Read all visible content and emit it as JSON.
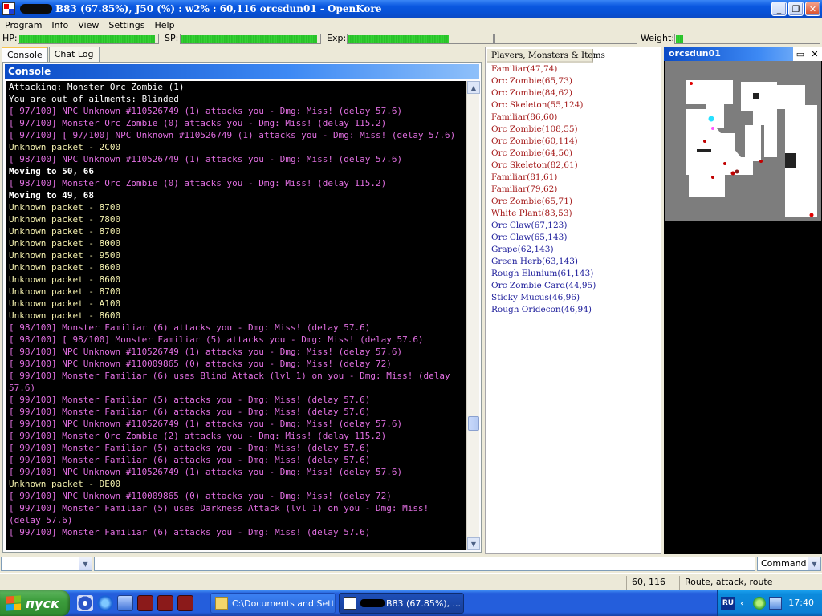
{
  "window": {
    "title": "B83 (67.85%), J50 (%) : w2% : 60,116 orcsdun01 - OpenKore",
    "btn_min": "_",
    "btn_max": "❐",
    "btn_close": "✕"
  },
  "menu": [
    "Program",
    "Info",
    "View",
    "Settings",
    "Help"
  ],
  "stats": {
    "hp_label": "HP:",
    "hp_fill": 0.98,
    "sp_label": "SP:",
    "sp_fill": 0.98,
    "exp_label": "Exp:",
    "exp_fill": 0.7,
    "weight_label": "Weight:",
    "weight_fill": 0.06
  },
  "tabs": [
    "Console",
    "Chat Log"
  ],
  "console": {
    "title": "Console",
    "lines": [
      {
        "c": "c-white",
        "t": "Attacking: Monster Orc Zombie (1)"
      },
      {
        "c": "c-white",
        "t": "You are out of ailments: Blinded"
      },
      {
        "c": "c-magenta",
        "t": "[ 97/100] NPC Unknown #110526749 (1) attacks you - Dmg: Miss! (delay 57.6)"
      },
      {
        "c": "c-magenta",
        "t": "[ 97/100] Monster Orc Zombie (0) attacks you - Dmg: Miss! (delay 115.2)"
      },
      {
        "c": "c-magenta",
        "t": "[ 97/100] [ 97/100] NPC Unknown #110526749 (1) attacks you - Dmg: Miss! (delay 57.6)"
      },
      {
        "c": "c-yellow",
        "t": "Unknown packet - 2C00"
      },
      {
        "c": "c-magenta",
        "t": "[ 98/100] NPC Unknown #110526749 (1) attacks you - Dmg: Miss! (delay 57.6)"
      },
      {
        "c": "c-white b",
        "t": "Moving to 50, 66"
      },
      {
        "c": "c-magenta",
        "t": "[ 98/100] Monster Orc Zombie (0) attacks you - Dmg: Miss! (delay 115.2)"
      },
      {
        "c": "c-white b",
        "t": "Moving to 49, 68"
      },
      {
        "c": "c-yellow",
        "t": "Unknown packet - 8700"
      },
      {
        "c": "c-yellow",
        "t": "Unknown packet - 7800"
      },
      {
        "c": "c-yellow",
        "t": "Unknown packet - 8700"
      },
      {
        "c": "c-yellow",
        "t": "Unknown packet - 8000"
      },
      {
        "c": "c-yellow",
        "t": "Unknown packet - 9500"
      },
      {
        "c": "c-yellow",
        "t": "Unknown packet - 8600"
      },
      {
        "c": "c-yellow",
        "t": "Unknown packet - 8600"
      },
      {
        "c": "c-yellow",
        "t": "Unknown packet - 8700"
      },
      {
        "c": "c-yellow",
        "t": "Unknown packet - A100"
      },
      {
        "c": "c-yellow",
        "t": "Unknown packet - 8600"
      },
      {
        "c": "c-magenta",
        "t": "[ 98/100] Monster Familiar (6) attacks you - Dmg: Miss! (delay 57.6)"
      },
      {
        "c": "c-magenta",
        "t": "[ 98/100] [ 98/100] Monster Familiar (5) attacks you - Dmg: Miss! (delay 57.6)"
      },
      {
        "c": "c-magenta",
        "t": "[ 98/100] NPC Unknown #110526749 (1) attacks you - Dmg: Miss! (delay 57.6)"
      },
      {
        "c": "c-magenta",
        "t": "[ 98/100] NPC Unknown #110009865 (0) attacks you - Dmg: Miss! (delay 72)"
      },
      {
        "c": "c-magenta",
        "t": "[ 99/100] Monster Familiar (6) uses Blind Attack (lvl 1) on you - Dmg: Miss! (delay 57.6)"
      },
      {
        "c": "c-magenta",
        "t": "[ 99/100] Monster Familiar (5) attacks you - Dmg: Miss! (delay 57.6)"
      },
      {
        "c": "c-magenta",
        "t": "[ 99/100] Monster Familiar (6) attacks you - Dmg: Miss! (delay 57.6)"
      },
      {
        "c": "c-magenta",
        "t": "[ 99/100] NPC Unknown #110526749 (1) attacks you - Dmg: Miss! (delay 57.6)"
      },
      {
        "c": "c-magenta",
        "t": "[ 99/100] Monster Orc Zombie (2) attacks you - Dmg: Miss! (delay 115.2)"
      },
      {
        "c": "c-magenta",
        "t": "[ 99/100] Monster Familiar (5) attacks you - Dmg: Miss! (delay 57.6)"
      },
      {
        "c": "c-magenta",
        "t": "[ 99/100] Monster Familiar (6) attacks you - Dmg: Miss! (delay 57.6)"
      },
      {
        "c": "c-magenta",
        "t": "[ 99/100] NPC Unknown #110526749 (1) attacks you - Dmg: Miss! (delay 57.6)"
      },
      {
        "c": "c-yellow",
        "t": "Unknown packet - DE00"
      },
      {
        "c": "c-magenta",
        "t": "[ 99/100] NPC Unknown #110009865 (0) attacks you - Dmg: Miss! (delay 72)"
      },
      {
        "c": "c-magenta",
        "t": "[ 99/100] Monster Familiar (5) uses Darkness Attack (lvl 1) on you - Dmg: Miss! (delay 57.6)"
      },
      {
        "c": "c-magenta",
        "t": "[ 99/100] Monster Familiar (6) attacks you - Dmg: Miss! (delay 57.6)"
      }
    ]
  },
  "entities": {
    "header": "Players, Monsters & Items",
    "items": [
      {
        "t": "Familiar(47,74)",
        "kind": "monster"
      },
      {
        "t": "Orc Zombie(65,73)",
        "kind": "monster"
      },
      {
        "t": "Orc Zombie(84,62)",
        "kind": "monster"
      },
      {
        "t": "Orc Skeleton(55,124)",
        "kind": "monster"
      },
      {
        "t": "Familiar(86,60)",
        "kind": "monster"
      },
      {
        "t": "Orc Zombie(108,55)",
        "kind": "monster"
      },
      {
        "t": "Orc Zombie(60,114)",
        "kind": "monster"
      },
      {
        "t": "Orc Zombie(64,50)",
        "kind": "monster"
      },
      {
        "t": "Orc Skeleton(82,61)",
        "kind": "monster"
      },
      {
        "t": "Familiar(81,61)",
        "kind": "monster"
      },
      {
        "t": "Familiar(79,62)",
        "kind": "monster"
      },
      {
        "t": "Orc Zombie(65,71)",
        "kind": "monster"
      },
      {
        "t": "White Plant(83,53)",
        "kind": "monster"
      },
      {
        "t": "Orc Claw(67,123)",
        "kind": "item"
      },
      {
        "t": "Orc Claw(65,143)",
        "kind": "item"
      },
      {
        "t": "Grape(62,143)",
        "kind": "item"
      },
      {
        "t": "Green Herb(63,143)",
        "kind": "item"
      },
      {
        "t": "Rough Elunium(61,143)",
        "kind": "item"
      },
      {
        "t": "Orc Zombie Card(44,95)",
        "kind": "item"
      },
      {
        "t": "Sticky Mucus(46,96)",
        "kind": "item"
      },
      {
        "t": "Rough Oridecon(46,94)",
        "kind": "item"
      }
    ]
  },
  "map": {
    "title": "orcsdun01",
    "btn_max": "▭",
    "btn_close": "✕"
  },
  "input": {
    "command_label": "Command",
    "command_value": ""
  },
  "statusbar": {
    "coords": "60, 116",
    "ai": "Route, attack, route"
  },
  "taskbar": {
    "start_label": "пуск",
    "task1": "C:\\Documents and Sett...",
    "task2": "B83 (67.85%), ...",
    "lang": "RU",
    "clock": "17:40"
  },
  "colors": {
    "magenta_text": "#e16fe1",
    "yellow_text": "#f2efad",
    "monster_text": "#a51b1b",
    "item_text": "#1b1b9a",
    "bar_green": "#28c228"
  }
}
